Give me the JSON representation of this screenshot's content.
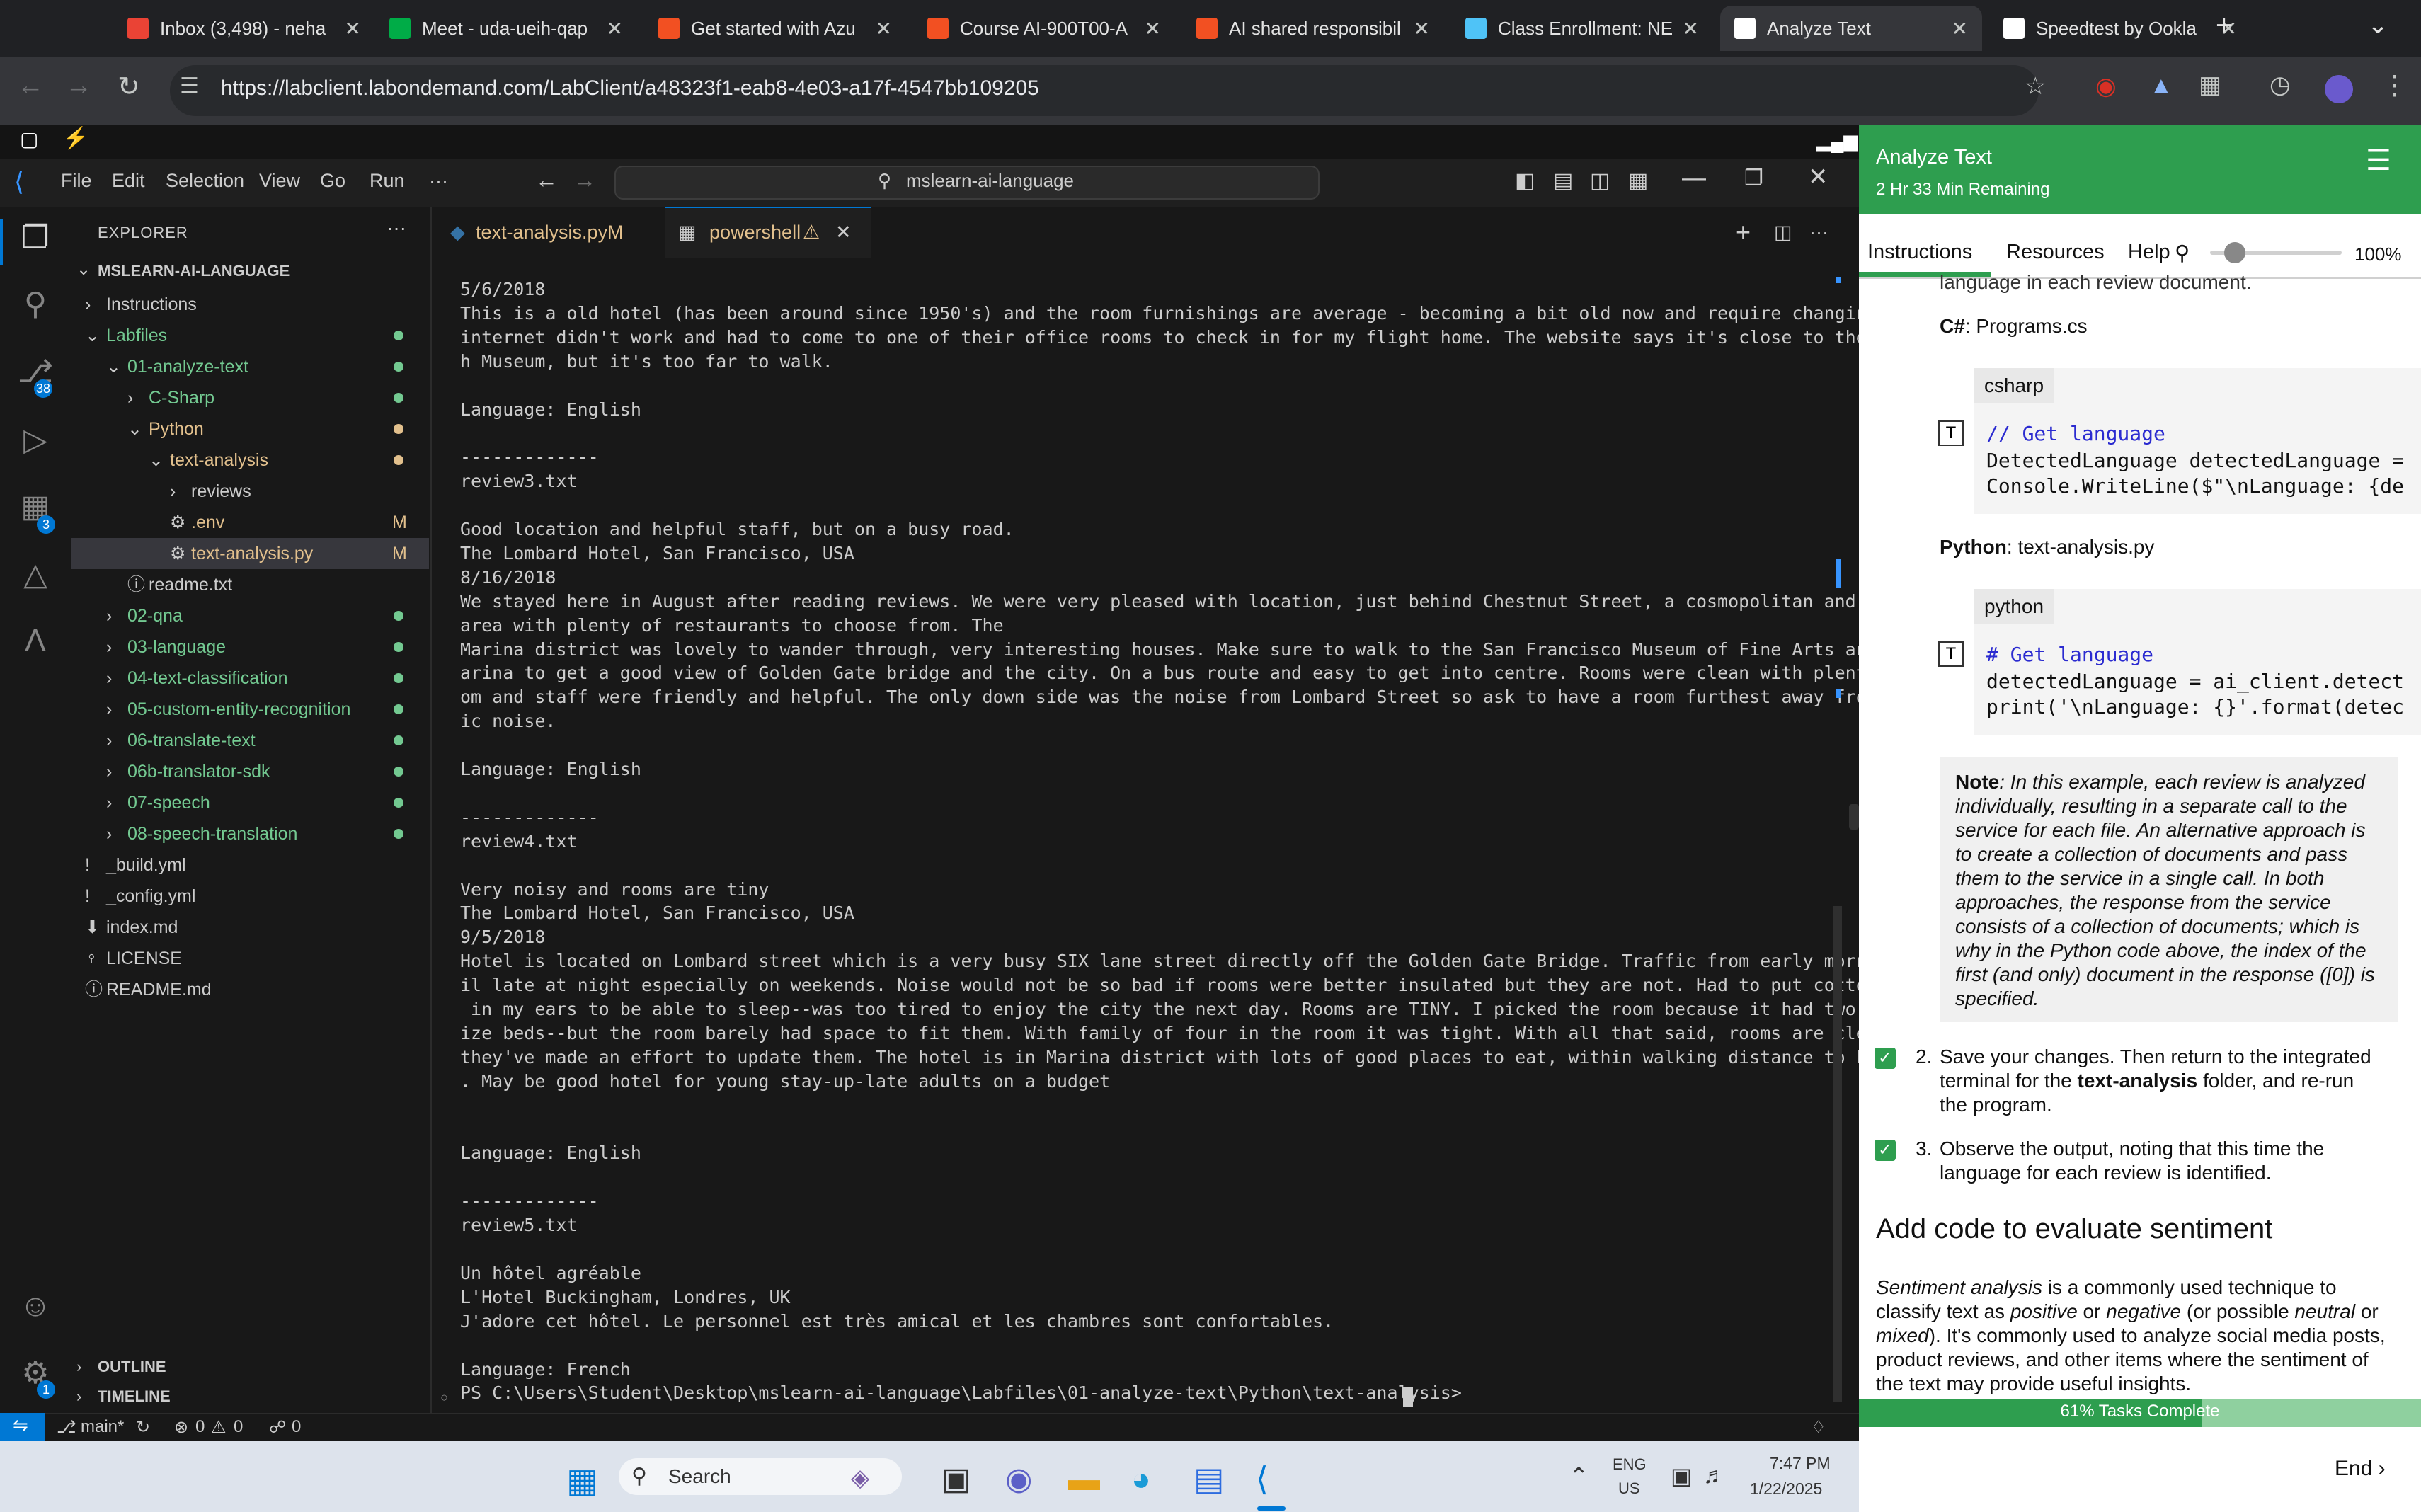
{
  "browser": {
    "tabs": [
      {
        "label": "Inbox (3,498) - neha",
        "favicon": "gmail-icon",
        "color": "#ea4335"
      },
      {
        "label": "Meet - uda-ueih-qap",
        "favicon": "meet-icon",
        "color": "#00ac47"
      },
      {
        "label": "Get started with Azu",
        "favicon": "microsoft-icon",
        "color": "#f25022"
      },
      {
        "label": "Course AI-900T00-A",
        "favicon": "microsoft-icon",
        "color": "#f25022"
      },
      {
        "label": "AI shared responsibil",
        "favicon": "microsoft-icon",
        "color": "#f25022"
      },
      {
        "label": "Class Enrollment: NE",
        "favicon": "check-icon",
        "color": "#4fc3f7"
      },
      {
        "label": "Analyze Text",
        "favicon": "lab-icon",
        "color": "#ffffff"
      },
      {
        "label": "Speedtest by Ookla",
        "favicon": "speedtest-icon",
        "color": "#ffffff"
      }
    ],
    "url": "https://labclient.labondemand.com/LabClient/a48323f1-eab8-4e03-a17f-4547bb109205"
  },
  "vscode": {
    "menu": [
      "File",
      "Edit",
      "Selection",
      "View",
      "Go",
      "Run",
      "···"
    ],
    "search_text": "mslearn-ai-language",
    "explorer_title": "EXPLORER",
    "root": "MSLEARN-AI-LANGUAGE",
    "tree": [
      {
        "label": "Instructions",
        "arrow": "›",
        "indent": 0,
        "cls": "",
        "dot": false,
        "flag": ""
      },
      {
        "label": "Labfiles",
        "arrow": "⌄",
        "indent": 0,
        "cls": "green",
        "dot": true,
        "flag": ""
      },
      {
        "label": "01-analyze-text",
        "arrow": "⌄",
        "indent": 1,
        "cls": "green",
        "dot": true,
        "flag": ""
      },
      {
        "label": "C-Sharp",
        "arrow": "›",
        "indent": 2,
        "cls": "green",
        "dot": true,
        "flag": ""
      },
      {
        "label": "Python",
        "arrow": "⌄",
        "indent": 2,
        "cls": "yellow",
        "dot": "y",
        "flag": ""
      },
      {
        "label": "text-analysis",
        "arrow": "⌄",
        "indent": 3,
        "cls": "yellow",
        "dot": "y",
        "flag": ""
      },
      {
        "label": "reviews",
        "arrow": "›",
        "indent": 4,
        "cls": "",
        "dot": false,
        "flag": ""
      },
      {
        "label": ".env",
        "arrow": "⚙",
        "indent": 4,
        "cls": "yellow",
        "dot": false,
        "flag": "M"
      },
      {
        "label": "text-analysis.py",
        "arrow": "⚙",
        "indent": 4,
        "cls": "yellow",
        "dot": false,
        "flag": "M"
      },
      {
        "label": "readme.txt",
        "arrow": "ⓘ",
        "indent": 2,
        "cls": "",
        "dot": false,
        "flag": ""
      },
      {
        "label": "02-qna",
        "arrow": "›",
        "indent": 1,
        "cls": "green",
        "dot": true,
        "flag": ""
      },
      {
        "label": "03-language",
        "arrow": "›",
        "indent": 1,
        "cls": "green",
        "dot": true,
        "flag": ""
      },
      {
        "label": "04-text-classification",
        "arrow": "›",
        "indent": 1,
        "cls": "green",
        "dot": true,
        "flag": ""
      },
      {
        "label": "05-custom-entity-recognition",
        "arrow": "›",
        "indent": 1,
        "cls": "green",
        "dot": true,
        "flag": ""
      },
      {
        "label": "06-translate-text",
        "arrow": "›",
        "indent": 1,
        "cls": "green",
        "dot": true,
        "flag": ""
      },
      {
        "label": "06b-translator-sdk",
        "arrow": "›",
        "indent": 1,
        "cls": "green",
        "dot": true,
        "flag": ""
      },
      {
        "label": "07-speech",
        "arrow": "›",
        "indent": 1,
        "cls": "green",
        "dot": true,
        "flag": ""
      },
      {
        "label": "08-speech-translation",
        "arrow": "›",
        "indent": 1,
        "cls": "green",
        "dot": true,
        "flag": ""
      },
      {
        "label": "_build.yml",
        "arrow": "!",
        "indent": 0,
        "cls": "",
        "dot": false,
        "flag": ""
      },
      {
        "label": "_config.yml",
        "arrow": "!",
        "indent": 0,
        "cls": "",
        "dot": false,
        "flag": ""
      },
      {
        "label": "index.md",
        "arrow": "⬇",
        "indent": 0,
        "cls": "",
        "dot": false,
        "flag": ""
      },
      {
        "label": "LICENSE",
        "arrow": "♀",
        "indent": 0,
        "cls": "",
        "dot": false,
        "flag": ""
      },
      {
        "label": "README.md",
        "arrow": "ⓘ",
        "indent": 0,
        "cls": "",
        "dot": false,
        "flag": ""
      }
    ],
    "outline": "OUTLINE",
    "timeline": "TIMELINE",
    "tabs": {
      "file": "text-analysis.py",
      "file_flag": "M",
      "terminal": "powershell"
    },
    "badges": {
      "scm": "38",
      "extensions": "3",
      "accounts": "1"
    },
    "terminal_lines": [
      "5/6/2018",
      "This is a old hotel (has been around since 1950's) and the room furnishings are average - becoming a bit old now and require changing. The",
      "internet didn't work and had to come to one of their office rooms to check in for my flight home. The website says it's close to the Britis",
      "h Museum, but it's too far to walk.",
      "",
      "Language: English",
      "",
      "-------------",
      "review3.txt",
      "",
      "Good location and helpful staff, but on a busy road.",
      "The Lombard Hotel, San Francisco, USA",
      "8/16/2018",
      "We stayed here in August after reading reviews. We were very pleased with location, just behind Chestnut Street, a cosmopolitan and trendy",
      "area with plenty of restaurants to choose from. The",
      "Marina district was lovely to wander through, very interesting houses. Make sure to walk to the San Francisco Museum of Fine Arts and the M",
      "arina to get a good view of Golden Gate bridge and the city. On a bus route and easy to get into centre. Rooms were clean with plenty of ro",
      "om and staff were friendly and helpful. The only down side was the noise from Lombard Street so ask to have a room furthest away from traff",
      "ic noise.",
      "",
      "Language: English",
      "",
      "-------------",
      "review4.txt",
      "",
      "Very noisy and rooms are tiny",
      "The Lombard Hotel, San Francisco, USA",
      "9/5/2018",
      "Hotel is located on Lombard street which is a very busy SIX lane street directly off the Golden Gate Bridge. Traffic from early morning unt",
      "il late at night especially on weekends. Noise would not be so bad if rooms were better insulated but they are not. Had to put cotton balls",
      " in my ears to be able to sleep--was too tired to enjoy the city the next day. Rooms are TINY. I picked the room because it had two queen s",
      "ize beds--but the room barely had space to fit them. With family of four in the room it was tight. With all that said, rooms are clean and",
      "they've made an effort to update them. The hotel is in Marina district with lots of good places to eat, within walking distance to Presidio",
      ". May be good hotel for young stay-up-late adults on a budget",
      "",
      "",
      "Language: English",
      "",
      "-------------",
      "review5.txt",
      "",
      "Un hôtel agréable",
      "L'Hotel Buckingham, Londres, UK",
      "J'adore cet hôtel. Le personnel est très amical et les chambres sont confortables.",
      "",
      "Language: French",
      "PS C:\\Users\\Student\\Desktop\\mslearn-ai-language\\Labfiles\\01-analyze-text\\Python\\text-analysis> "
    ],
    "status": {
      "branch": "main*",
      "errors": "0",
      "warnings": "0",
      "ports": "0"
    }
  },
  "lab": {
    "title": "Analyze Text",
    "time_remaining": "2 Hr 33 Min Remaining",
    "tabs": [
      "Instructions",
      "Resources",
      "Help"
    ],
    "zoom": "100%",
    "cut_text": "language in each review document.",
    "csharp_label_bold": "C#",
    "csharp_file": ": Programs.cs",
    "csharp_tag": "csharp",
    "csharp_code": [
      "// Get language",
      "DetectedLanguage detectedLanguage =",
      "Console.WriteLine($\"\\nLanguage: {de"
    ],
    "python_label_bold": "Python",
    "python_file": ": text-analysis.py",
    "python_tag": "python",
    "python_code": [
      "# Get language",
      "detectedLanguage = ai_client.detect",
      "print('\\nLanguage: {}'.format(detec"
    ],
    "note_bold": "Note",
    "note_lines": [
      ": In this example, each review is analyzed",
      "individually, resulting in a separate call to the",
      "service for each file. An alternative approach is",
      "to create a collection of documents and pass",
      "them to the service in a single call. In both",
      "approaches, the response from the service",
      "consists of a collection of documents; which is",
      "why in the Python code above, the index of the",
      "first (and only) document in the response ([0]) is",
      "specified."
    ],
    "step2_num": "2.",
    "step2_lines": [
      "Save your changes. Then return to the integrated",
      "terminal for the ",
      "text-analysis",
      " folder, and re-run",
      "the program."
    ],
    "step3_num": "3.",
    "step3_lines": [
      "Observe the output, noting that this time the",
      "language for each review is identified."
    ],
    "heading": "Add code to evaluate sentiment",
    "para_lines": [
      "Sentiment analysis",
      " is a commonly used technique to",
      "classify text as ",
      "positive",
      " or ",
      "negative",
      " (or possible ",
      "neutral",
      " or",
      "mixed",
      "). It's commonly used to analyze social media posts,",
      "product reviews, and other items where the sentiment of",
      "the text may provide useful insights."
    ],
    "progress_label": "61% Tasks Complete",
    "progress_value": 0.61,
    "end_label": "End"
  },
  "taskbar": {
    "search_placeholder": "Search",
    "lang_top": "ENG",
    "lang_bottom": "US",
    "time": "7:47 PM",
    "date": "1/22/2025"
  }
}
